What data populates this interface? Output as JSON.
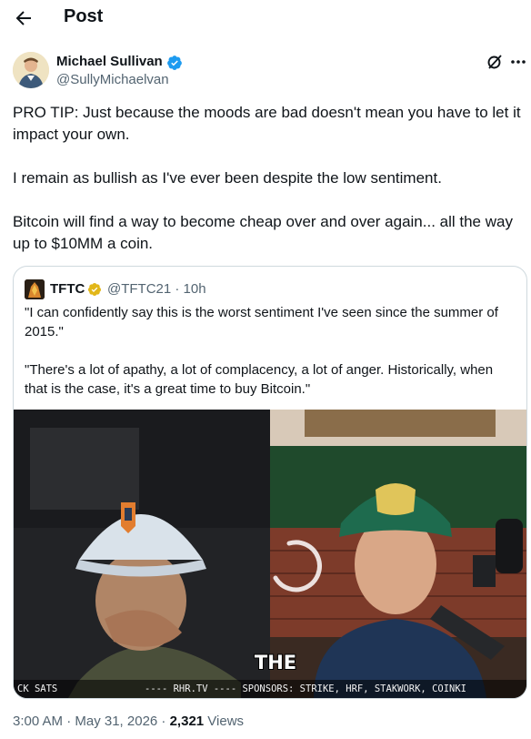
{
  "header": {
    "title": "Post",
    "back_icon": "arrow-left-icon"
  },
  "post": {
    "author_name": "Michael Sullivan",
    "author_handle": "@SullyMichaelvan",
    "verified_color": "#1d9bf0",
    "paragraphs": [
      "PRO TIP: Just because the moods are bad doesn't mean you have to let it impact your own.",
      "I remain as bullish as I've ever been despite the low sentiment.",
      "Bitcoin will find a way to become cheap over and over again... all the way up to $10MM a coin."
    ]
  },
  "quote": {
    "name": "TFTC",
    "handle_time": "@TFTC21 · 10h",
    "badge_color": "#e2b719",
    "paragraphs": [
      "\"I can confidently say this is the worst sentiment I've seen since the summer of 2015.\"",
      "\"There's a lot of apathy, a lot of complacency, a lot of anger. Historically, when that is the case, it's a great time to buy Bitcoin.\""
    ],
    "video": {
      "caption": "THE",
      "ticker_left": "CK SATS",
      "ticker_right": "---- RHR.TV ---- SPONSORS: STRIKE, HRF, STAKWORK, COINKI"
    }
  },
  "meta": {
    "timestamp": "3:00 AM · May 31, 2026 · ",
    "views_count": "2,321",
    "views_label": " Views"
  }
}
